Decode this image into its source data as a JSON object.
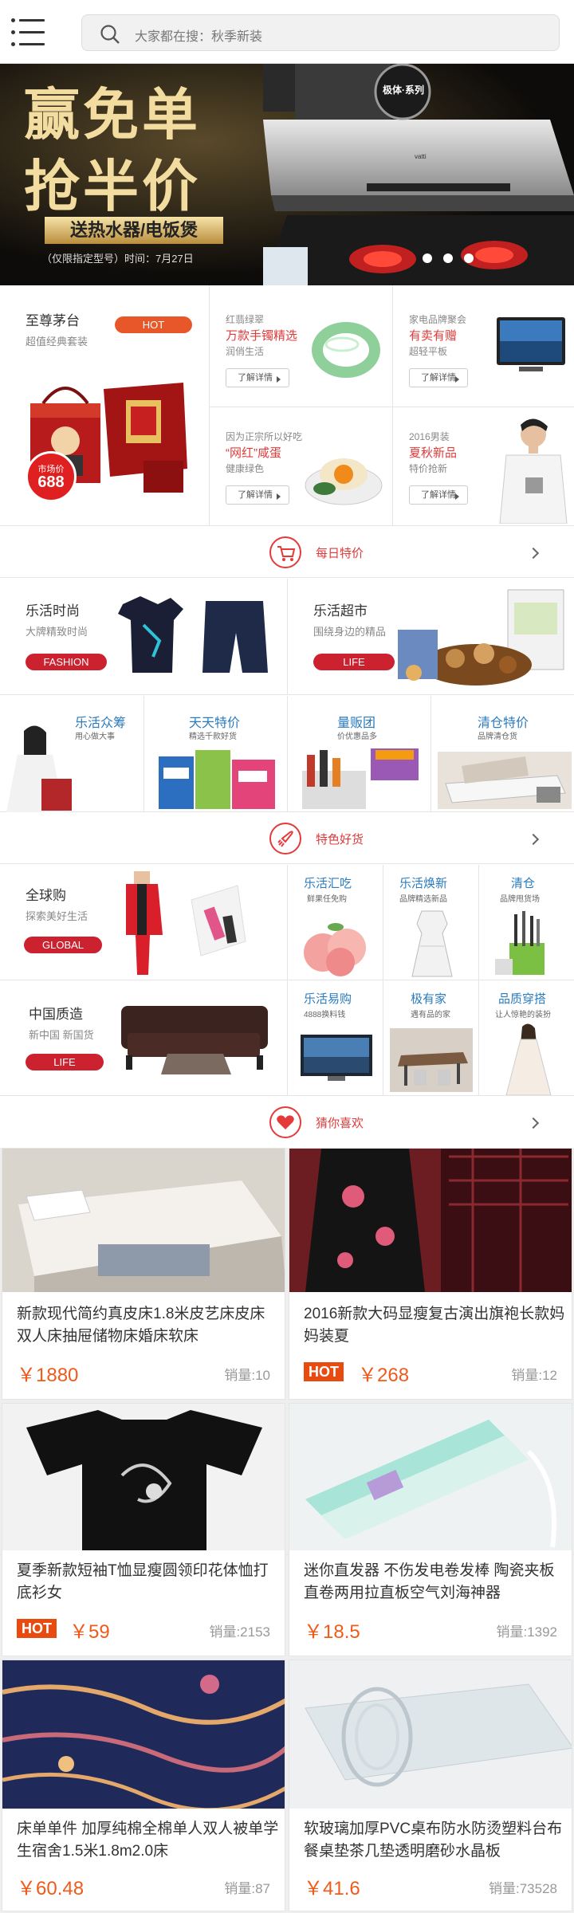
{
  "search": {
    "placeholder": "大家都在搜：秋季新装"
  },
  "banner": {
    "headline1": "赢免单",
    "headline2": "抢半价",
    "gift": "送热水器/电饭煲",
    "note": "（仅限指定型号）时间：7月27日",
    "brand_badge": "极体·系列",
    "brand_name": "vatti"
  },
  "promo": {
    "maotai": {
      "title": "至尊茅台",
      "subtitle": "超值经典套装",
      "tag": "HOT",
      "price_label": "市场价",
      "price": "688"
    },
    "tiles": [
      {
        "small": "红翡绿翠",
        "title": "万款手镯精选",
        "sub": "润俏生活",
        "button": "了解详情"
      },
      {
        "small": "家电品牌聚会",
        "title": "有卖有赠",
        "sub": "超轻平板",
        "button": "了解详情"
      },
      {
        "small": "因为正宗所以好吃",
        "title": "“网红”咸蛋",
        "sub": "健康绿色",
        "button": "了解详情"
      },
      {
        "small": "2016男装",
        "title": "夏秋新品",
        "sub": "特价抢新",
        "button": "了解详情"
      }
    ]
  },
  "sections": {
    "daily": "每日特价",
    "featured": "特色好货",
    "guess": "猜你喜欢"
  },
  "lifestyle": {
    "fashion": {
      "title": "乐活时尚",
      "subtitle": "大牌精致时尚",
      "tag": "FASHION"
    },
    "market": {
      "title": "乐活超市",
      "subtitle": "围绕身边的精品",
      "tag": "LIFE"
    },
    "small": [
      {
        "title": "乐活众筹",
        "sub": "用心做大事"
      },
      {
        "title": "天天特价",
        "sub": "精选千款好货"
      },
      {
        "title": "量贩团",
        "sub": "价优惠品多"
      },
      {
        "title": "清仓特价",
        "sub": "品牌清仓货"
      }
    ]
  },
  "featured": {
    "global": {
      "title": "全球购",
      "subtitle": "探索美好生活",
      "tag": "GLOBAL"
    },
    "china": {
      "title": "中国质造",
      "subtitle": "新中国 新国货",
      "tag": "LIFE"
    },
    "cells": [
      {
        "title": "乐活汇吃",
        "sub": "鲜果任免购"
      },
      {
        "title": "乐活焕新",
        "sub": "品牌精选新品"
      },
      {
        "title": "清仓",
        "sub": "品牌甩货场"
      },
      {
        "title": "乐活易购",
        "sub": "4888换料钱"
      },
      {
        "title": "极有家",
        "sub": "遇有品的家"
      },
      {
        "title": "品质穿搭",
        "sub": "让人惊艳的装扮"
      }
    ]
  },
  "products": [
    {
      "name": "新款现代简约真皮床1.8米皮艺床皮床双人床抽屉储物床婚床软床",
      "price": "￥1880",
      "sales": "销量:10",
      "hot": ""
    },
    {
      "name": "2016新款大码显瘦复古演出旗袍长款妈妈装夏",
      "price": "￥268",
      "sales": "销量:12",
      "hot": "HOT"
    },
    {
      "name": "夏季新款短袖T恤显瘦圆领印花体恤打底衫女",
      "price": "￥59",
      "sales": "销量:2153",
      "hot": "HOT"
    },
    {
      "name": "迷你直发器 不伤发电卷发棒 陶瓷夹板直卷两用拉直板空气刘海神器",
      "price": "￥18.5",
      "sales": "销量:1392",
      "hot": ""
    },
    {
      "name": "床单单件 加厚纯棉全棉单人双人被单学生宿舍1.5米1.8m2.0床",
      "price": "￥60.48",
      "sales": "销量:87",
      "hot": ""
    },
    {
      "name": "软玻璃加厚PVC桌布防水防烫塑料台布餐桌垫茶几垫透明磨砂水晶板",
      "price": "￥41.6",
      "sales": "销量:73528",
      "hot": ""
    }
  ],
  "colors": {
    "accent": "#e03b3b",
    "price": "#f05a1a",
    "tag_red": "#cc2230",
    "link_blue": "#2a7bbd"
  }
}
